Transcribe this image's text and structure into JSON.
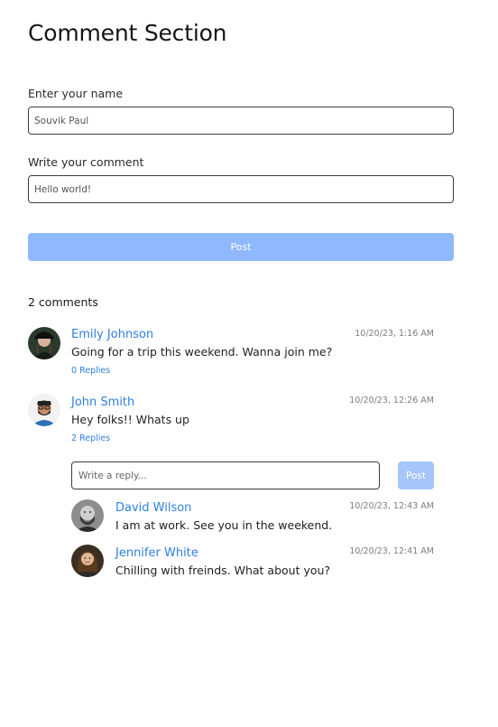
{
  "page_title": "Comment Section",
  "form": {
    "name_label": "Enter your name",
    "name_value": "Souvik Paul",
    "comment_label": "Write your comment",
    "comment_value": "Hello world!",
    "post_label": "Post"
  },
  "comments_count": "2 comments",
  "comments": [
    {
      "name": "Emily Johnson",
      "time": "10/20/23, 1:16 AM",
      "text": "Going for a trip this weekend. Wanna join me?",
      "replies_label": "0 Replies"
    },
    {
      "name": "John Smith",
      "time": "10/20/23, 12:26 AM",
      "text": "Hey folks!! Whats up",
      "replies_label": "2 Replies"
    }
  ],
  "reply_box": {
    "placeholder": "Write a reply...",
    "post_label": "Post"
  },
  "replies": [
    {
      "name": "David Wilson",
      "time": "10/20/23, 12:43 AM",
      "text": "I am at work. See you in the weekend."
    },
    {
      "name": "Jennifer White",
      "time": "10/20/23, 12:41 AM",
      "text": "Chilling with freinds. What about you?"
    }
  ],
  "colors": {
    "accent": "#2f7fe0",
    "post_button": "#8fb8fd",
    "reply_post_button": "#a6c6fb"
  }
}
